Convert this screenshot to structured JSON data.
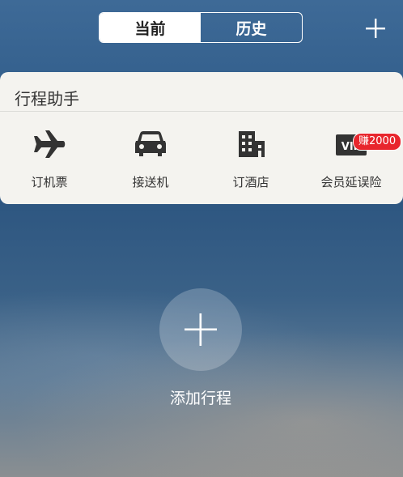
{
  "tabs": {
    "current": "当前",
    "history": "历史"
  },
  "assistant": {
    "title": "行程助手",
    "services": [
      {
        "label": "订机票",
        "icon": "airplane-icon"
      },
      {
        "label": "接送机",
        "icon": "car-icon"
      },
      {
        "label": "订酒店",
        "icon": "hotel-icon"
      },
      {
        "label": "会员延误险",
        "icon": "vip-icon"
      }
    ],
    "vip_badge": "赚2000",
    "vip_icon_text": "VIP"
  },
  "add_trip": {
    "label": "添加行程"
  },
  "colors": {
    "badge": "#e8262d",
    "card_bg": "#f4f3ef",
    "icon": "#333333"
  }
}
